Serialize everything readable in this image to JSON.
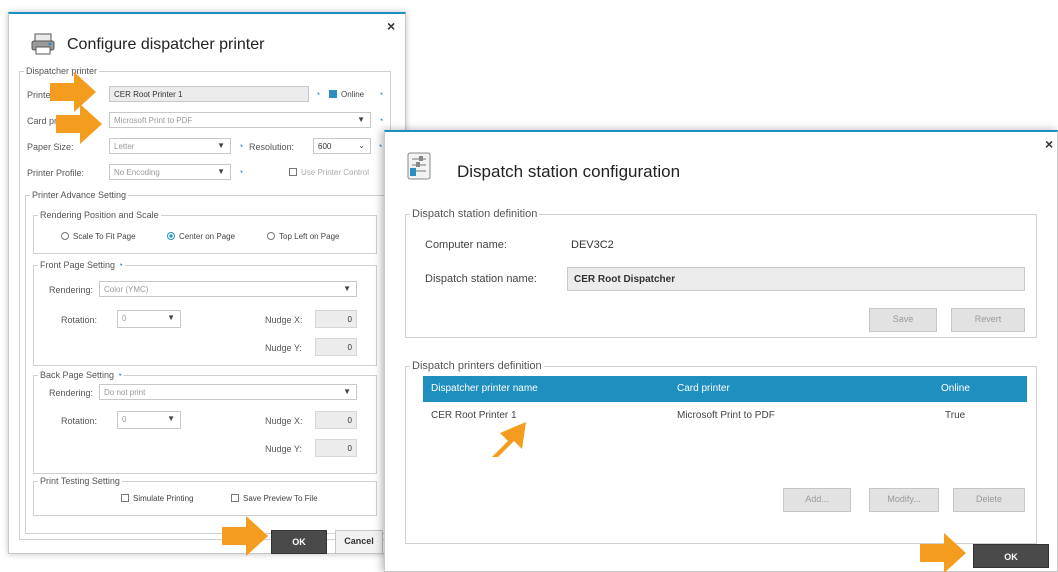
{
  "configure_dialog": {
    "title": "Configure dispatcher printer",
    "close": "×",
    "group_dispatcher_printer": "Dispatcher printer",
    "printer_name_label": "Printer name:",
    "printer_name_value": "CER Root Printer 1",
    "online_label": "Online",
    "card_printer_label": "Card printer:",
    "card_printer_value": "Microsoft Print to PDF",
    "paper_size_label": "Paper Size:",
    "paper_size_value": "Letter",
    "resolution_label": "Resolution:",
    "resolution_value": "600",
    "printer_profile_label": "Printer Profile:",
    "printer_profile_value": "No Encoding",
    "use_printer_control": "Use Printer Control",
    "group_advance": "Printer Advance Setting",
    "group_rendering_position": "Rendering Position and Scale",
    "radio_scale_to_fit": "Scale To Fit Page",
    "radio_center": "Center on Page",
    "radio_top_left": "Top Left on Page",
    "group_front_page": "Front Page Setting",
    "front_rendering_label": "Rendering:",
    "front_rendering_value": "Color (YMC)",
    "front_rotation_label": "Rotation:",
    "front_rotation_value": "0",
    "front_nudge_x_label": "Nudge X:",
    "front_nudge_x_value": "0",
    "front_nudge_y_label": "Nudge Y:",
    "front_nudge_y_value": "0",
    "group_back_page": "Back Page Setting",
    "back_rendering_label": "Rendering:",
    "back_rendering_value": "Do not print",
    "back_rotation_label": "Rotation:",
    "back_rotation_value": "0",
    "back_nudge_x_label": "Nudge X:",
    "back_nudge_x_value": "0",
    "back_nudge_y_label": "Nudge Y:",
    "back_nudge_y_value": "0",
    "group_print_testing": "Print Testing Setting",
    "simulate_printing": "Simulate Printing",
    "save_preview": "Save Preview To File",
    "ok_label": "OK",
    "cancel_label": "Cancel"
  },
  "station_dialog": {
    "title": "Dispatch station configuration",
    "close": "×",
    "group_definition": "Dispatch station definition",
    "computer_name_label": "Computer name:",
    "computer_name_value": "DEV3C2",
    "station_name_label": "Dispatch station name:",
    "station_name_value": "CER Root Dispatcher",
    "save_label": "Save",
    "revert_label": "Revert",
    "group_printers": "Dispatch printers definition",
    "columns": [
      "Dispatcher printer name",
      "Card printer",
      "Online"
    ],
    "rows": [
      [
        "CER Root Printer 1",
        "Microsoft Print to PDF",
        "True"
      ]
    ],
    "add_label": "Add...",
    "modify_label": "Modify...",
    "delete_label": "Delete",
    "ok_label": "OK"
  },
  "colors": {
    "accent": "#1f8fbf",
    "arrow": "#f39c1e"
  }
}
